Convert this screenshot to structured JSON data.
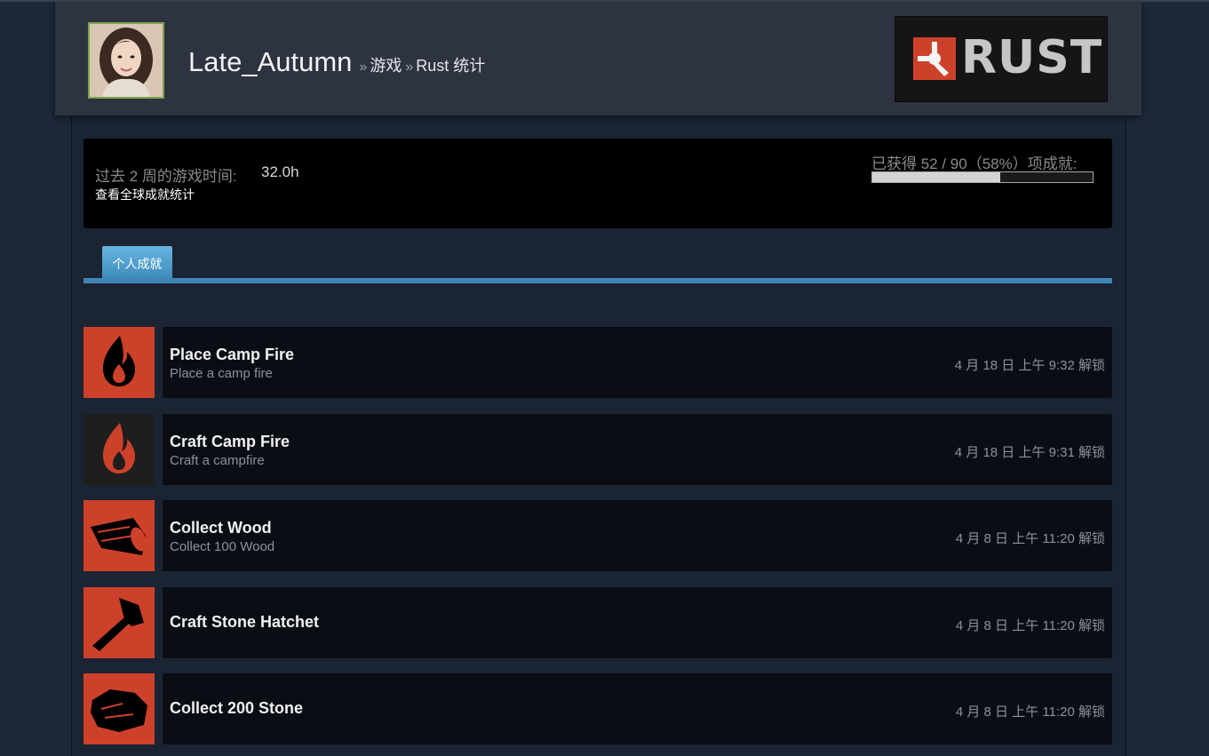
{
  "profile": {
    "username": "Late_Autumn",
    "breadcrumbs": [
      "游戏",
      "Rust 统计"
    ],
    "separator": "»"
  },
  "game": {
    "logo_text": "RUST",
    "accent_color": "#cd412b"
  },
  "stats": {
    "playtime_label": "过去 2 周的游戏时间:",
    "playtime_value": "32.0h",
    "global_stats_link": "查看全球成就统计",
    "achievements_summary": "已获得 52 / 90（58%）项成就:",
    "progress_fraction": 0.58
  },
  "tabs": [
    {
      "label": "个人成就",
      "active": true
    }
  ],
  "achievements": [
    {
      "title": "Place Camp Fire",
      "description": "Place a camp fire",
      "unlock_time": "4 月 18 日 上午 9:32 解锁",
      "icon": "campfire-icon",
      "icon_bg": "#cd412b",
      "icon_fg": "#000000"
    },
    {
      "title": "Craft Camp Fire",
      "description": "Craft a campfire",
      "unlock_time": "4 月 18 日 上午 9:31 解锁",
      "icon": "campfire-icon",
      "icon_bg": "#1e1e1e",
      "icon_fg": "#cd412b"
    },
    {
      "title": "Collect Wood",
      "description": "Collect 100 Wood",
      "unlock_time": "4 月 8 日 上午 11:20 解锁",
      "icon": "wood-log-icon",
      "icon_bg": "#cd412b",
      "icon_fg": "#000000"
    },
    {
      "title": "Craft Stone Hatchet",
      "description": "",
      "unlock_time": "4 月 8 日 上午 11:20 解锁",
      "icon": "hatchet-icon",
      "icon_bg": "#cd412b",
      "icon_fg": "#000000"
    },
    {
      "title": "Collect 200 Stone",
      "description": "",
      "unlock_time": "4 月 8 日 上午 11:20 解锁",
      "icon": "stone-icon",
      "icon_bg": "#cd412b",
      "icon_fg": "#000000"
    }
  ]
}
